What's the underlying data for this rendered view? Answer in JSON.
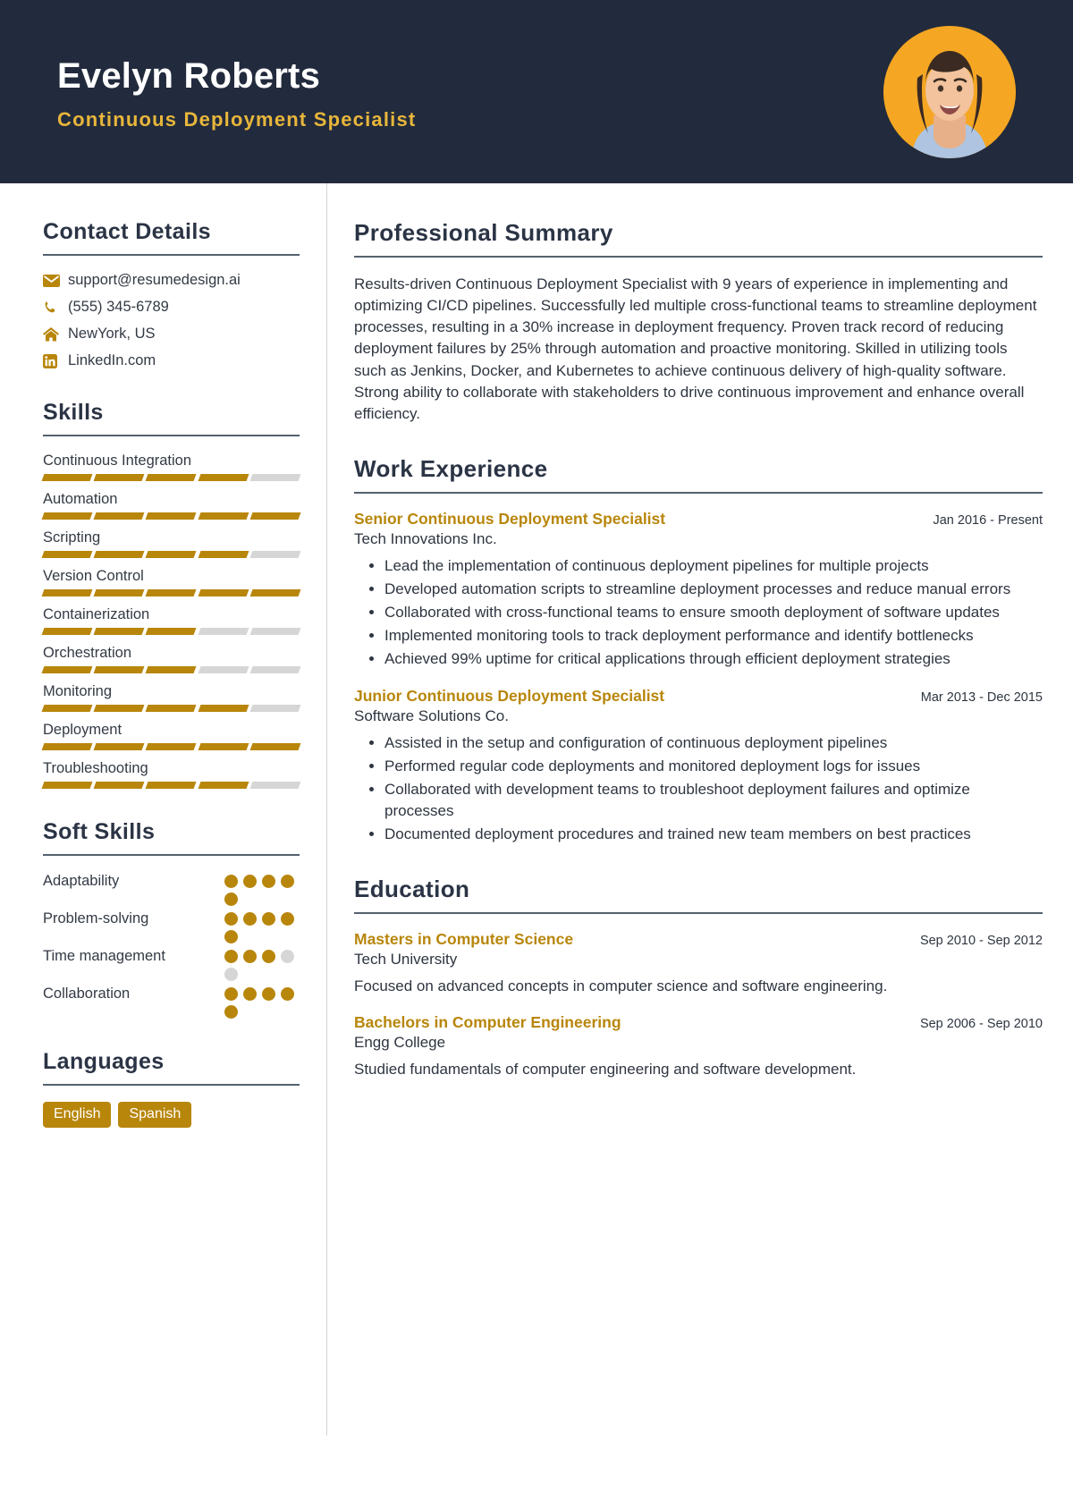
{
  "theme": {
    "header_bg": "#222b3d",
    "accent_gold": "#b8860b",
    "title_gold": "#e8b63b",
    "text_dark": "#2e3540",
    "rule": "#55616f",
    "segment_off": "#d6d6d6",
    "avatar_bg": "#f5a623"
  },
  "header": {
    "name": "Evelyn Roberts",
    "job_title": "Continuous Deployment Specialist",
    "avatar_alt": "profile-photo"
  },
  "sidebar": {
    "contact": {
      "title": "Contact Details",
      "items": [
        {
          "icon": "email-icon",
          "value": "support@resumedesign.ai"
        },
        {
          "icon": "phone-icon",
          "value": "(555) 345-6789"
        },
        {
          "icon": "home-icon",
          "value": "NewYork, US"
        },
        {
          "icon": "linkedin-icon",
          "value": "LinkedIn.com"
        }
      ]
    },
    "skills": {
      "title": "Skills",
      "max": 5,
      "items": [
        {
          "name": "Continuous Integration",
          "level": 4
        },
        {
          "name": "Automation",
          "level": 5
        },
        {
          "name": "Scripting",
          "level": 4
        },
        {
          "name": "Version Control",
          "level": 5
        },
        {
          "name": "Containerization",
          "level": 3
        },
        {
          "name": "Orchestration",
          "level": 3
        },
        {
          "name": "Monitoring",
          "level": 4
        },
        {
          "name": "Deployment",
          "level": 5
        },
        {
          "name": "Troubleshooting",
          "level": 4
        }
      ]
    },
    "soft_skills": {
      "title": "Soft Skills",
      "max": 5,
      "items": [
        {
          "name": "Adaptability",
          "level": 5
        },
        {
          "name": "Problem-solving",
          "level": 5
        },
        {
          "name": "Time management",
          "level": 3
        },
        {
          "name": "Collaboration",
          "level": 5
        }
      ]
    },
    "languages": {
      "title": "Languages",
      "items": [
        "English",
        "Spanish"
      ]
    }
  },
  "main": {
    "summary": {
      "title": "Professional Summary",
      "text": "Results-driven Continuous Deployment Specialist with 9 years of experience in implementing and optimizing CI/CD pipelines. Successfully led multiple cross-functional teams to streamline deployment processes, resulting in a 30% increase in deployment frequency. Proven track record of reducing deployment failures by 25% through automation and proactive monitoring. Skilled in utilizing tools such as Jenkins, Docker, and Kubernetes to achieve continuous delivery of high-quality software. Strong ability to collaborate with stakeholders to drive continuous improvement and enhance overall efficiency."
    },
    "work": {
      "title": "Work Experience",
      "entries": [
        {
          "role": "Senior Continuous Deployment Specialist",
          "date": "Jan 2016 - Present",
          "org": "Tech Innovations Inc.",
          "bullets": [
            "Lead the implementation of continuous deployment pipelines for multiple projects",
            "Developed automation scripts to streamline deployment processes and reduce manual errors",
            "Collaborated with cross-functional teams to ensure smooth deployment of software updates",
            "Implemented monitoring tools to track deployment performance and identify bottlenecks",
            "Achieved 99% uptime for critical applications through efficient deployment strategies"
          ]
        },
        {
          "role": "Junior Continuous Deployment Specialist",
          "date": "Mar 2013 - Dec 2015",
          "org": "Software Solutions Co.",
          "bullets": [
            "Assisted in the setup and configuration of continuous deployment pipelines",
            "Performed regular code deployments and monitored deployment logs for issues",
            "Collaborated with development teams to troubleshoot deployment failures and optimize processes",
            "Documented deployment procedures and trained new team members on best practices"
          ]
        }
      ]
    },
    "education": {
      "title": "Education",
      "entries": [
        {
          "degree": "Masters in Computer Science",
          "date": "Sep 2010 - Sep 2012",
          "school": "Tech University",
          "desc": "Focused on advanced concepts in computer science and software engineering."
        },
        {
          "degree": "Bachelors in Computer Engineering",
          "date": "Sep 2006 - Sep 2010",
          "school": "Engg College",
          "desc": "Studied fundamentals of computer engineering and software development."
        }
      ]
    }
  }
}
